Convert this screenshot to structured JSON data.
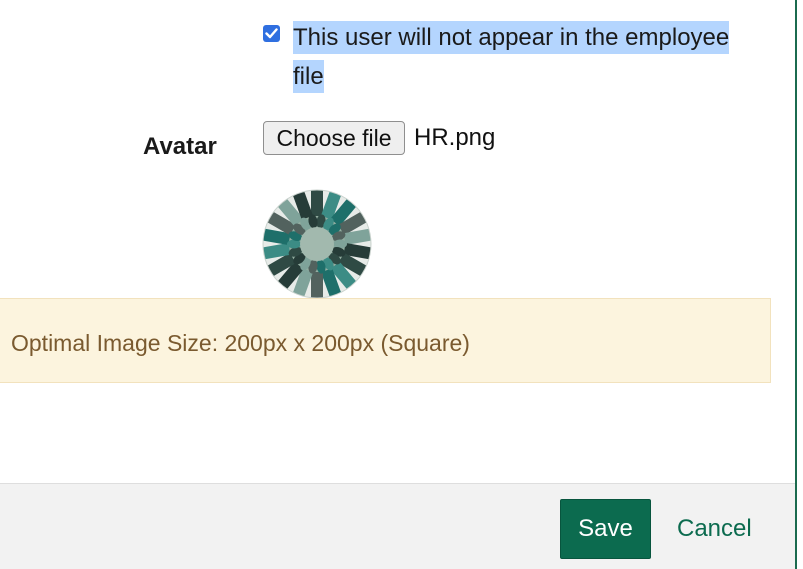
{
  "employee_file_option": {
    "checked": true,
    "label": "This user will not appear in the employee file"
  },
  "avatar": {
    "label": "Avatar",
    "choose_button_label": "Choose file",
    "file_name": "HR.png",
    "preview_icon": "hands-circle-avatar-icon"
  },
  "notice": {
    "text": "Optimal Image Size: 200px x 200px (Square)"
  },
  "footer": {
    "save_label": "Save",
    "cancel_label": "Cancel"
  },
  "colors": {
    "primary": "#0c6b4f",
    "checkbox": "#2f6fe0",
    "selection_highlight": "#b4d5fe",
    "notice_bg": "#fcf4de",
    "notice_text": "#7a5a2f",
    "footer_bg": "#f2f2f2"
  }
}
